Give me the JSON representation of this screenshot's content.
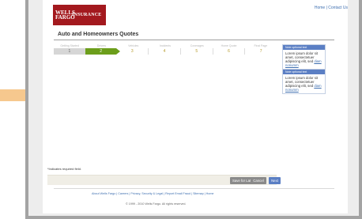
{
  "brand": {
    "line1": "WELLS",
    "line2": "FARGO",
    "suffix": "INSURANCE",
    "color": "#a3191e"
  },
  "toplinks": {
    "home": "Home",
    "separator": "|",
    "contact": "Contact Us"
  },
  "page_title": "Auto and Homeowners Quotes",
  "steps": [
    {
      "label": "Getting Started",
      "number": "1"
    },
    {
      "label": "Drivers",
      "number": "2"
    },
    {
      "label": "Vehicles",
      "number": "3"
    },
    {
      "label": "Incidents",
      "number": "4"
    },
    {
      "label": "Coverages",
      "number": "5"
    },
    {
      "label": "Home Quote",
      "number": "6"
    },
    {
      "label": "Final Page",
      "number": "7"
    }
  ],
  "sideboxes": [
    {
      "header": "Note optional text",
      "body": "Lorem ipsum dolor sit amet, consectetuer adipiscing elit, sed",
      "link": "diam nonumm"
    },
    {
      "header": "Note optional text",
      "body": "Lorem ipsum dolor sit amet, consectetuer adipiscing elit, sed",
      "link": "diam nonumm"
    }
  ],
  "required_note": "*Indicates required field.",
  "buttons": {
    "save_later": "Save for Later",
    "cancel": "Cancel",
    "next": "Next"
  },
  "footer_links": "About Wells Fargo | Careers | Privacy, Security & Legal | Report Email Fraud | Sitemap | Home",
  "copyright": "© 1999 - 2010 Wells Fargo. All rights reserved.",
  "colors": {
    "accent_green": "#6c9e1b",
    "accent_blue": "#5b7fc4"
  }
}
